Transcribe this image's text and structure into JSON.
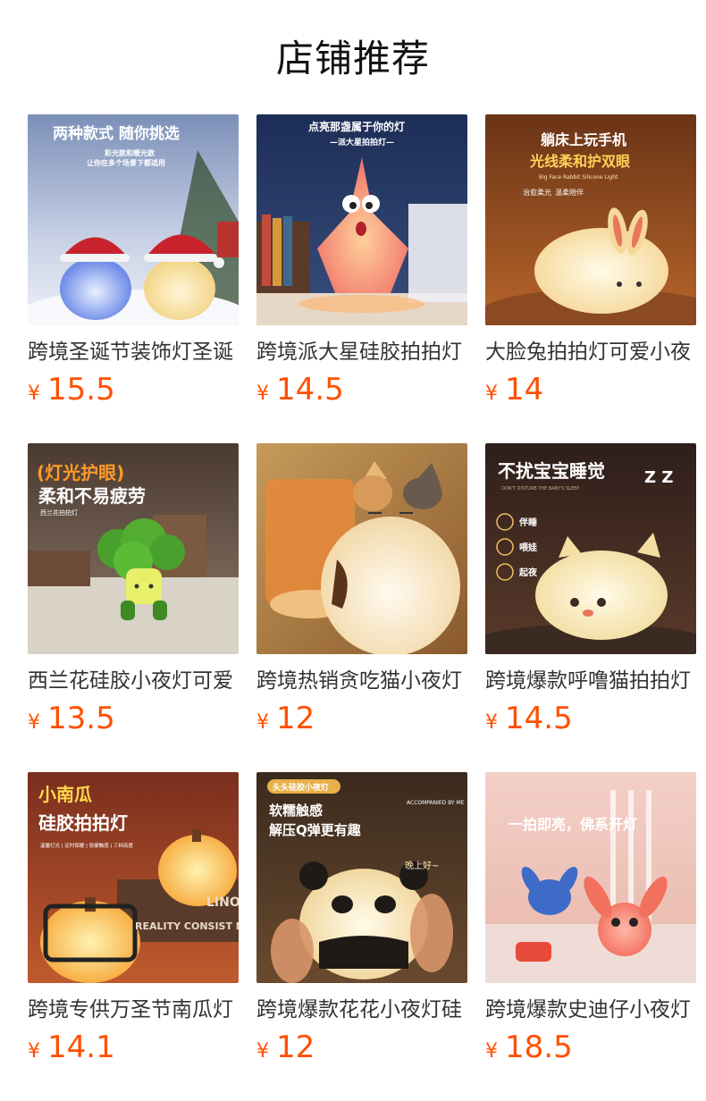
{
  "shop": {
    "title": "店铺推荐"
  },
  "currency_symbol": "¥",
  "accent_color": "#ff5000",
  "products": [
    {
      "name": "跨境圣诞节装饰灯圣诞",
      "price": "15.5",
      "image_text": [
        "两种款式 随你挑选",
        "彩光款和暖光款",
        "让你在多个场景下都适用"
      ]
    },
    {
      "name": "跨境派大星硅胶拍拍灯",
      "price": "14.5",
      "image_text": [
        "点亮那盏属于你的灯",
        "—派大星拍拍灯—"
      ]
    },
    {
      "name": "大脸兔拍拍灯可爱小夜",
      "price": "14",
      "image_text": [
        "躺床上玩手机",
        "光线柔和护双眼",
        "Big Face Rabbit Silicone Light",
        "治愈柔光",
        "温柔陪伴"
      ]
    },
    {
      "name": "西兰花硅胶小夜灯可爱",
      "price": "13.5",
      "image_text": [
        "(灯光护眼)",
        "柔和不易疲劳",
        "西兰花拍拍灯"
      ]
    },
    {
      "name": "跨境热销贪吃猫小夜灯",
      "price": "12",
      "image_text": []
    },
    {
      "name": "跨境爆款呼噜猫拍拍灯",
      "price": "14.5",
      "image_text": [
        "不扰宝宝睡觉",
        "DON'T DISTURB THE BABY'S SLEEP",
        "伴睡",
        "喂娃",
        "起夜",
        "Z Z"
      ]
    },
    {
      "name": "跨境专供万圣节南瓜灯",
      "price": "14.1",
      "image_text": [
        "小南瓜",
        "硅胶拍拍灯",
        "温馨灯光 | 定时保暖 | 软硬触感 | 三档亮度",
        "LINO",
        "REALITY CONSIST MA"
      ]
    },
    {
      "name": "跨境爆款花花小夜灯硅",
      "price": "12",
      "image_text": [
        "头头硅胶小夜灯",
        "软糯触感",
        "解压Q弹更有趣",
        "ACCOMPANIED BY ME",
        "晚上好~"
      ]
    },
    {
      "name": "跨境爆款史迪仔小夜灯",
      "price": "18.5",
      "image_text": [
        "一拍即亮，佛系开灯"
      ]
    }
  ]
}
